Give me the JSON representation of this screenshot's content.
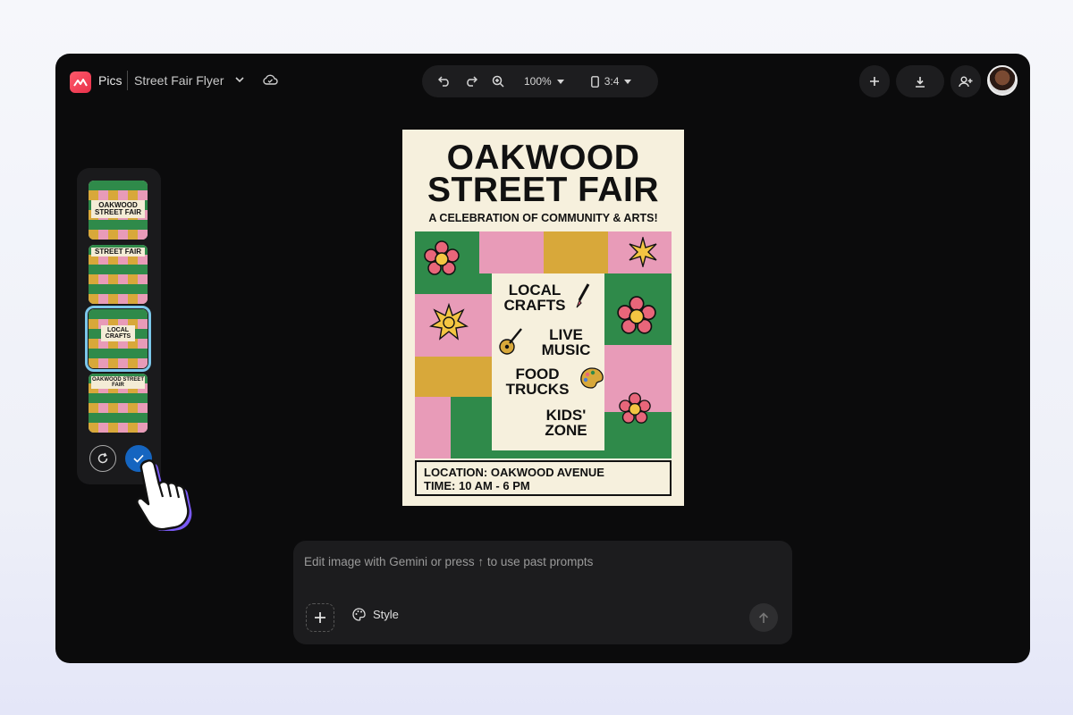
{
  "header": {
    "app_name": "Pics",
    "doc_title": "Street Fair Flyer",
    "zoom": "100%",
    "aspect_ratio": "3:4"
  },
  "thumbnails": [
    {
      "title": "OAKWOOD STREET FAIR"
    },
    {
      "title": "STREET FAIR"
    },
    {
      "title": "LOCAL CRAFTS"
    },
    {
      "title": "OAKWOOD STREET FAIR"
    }
  ],
  "selected_thumbnail": 3,
  "flyer": {
    "title_line1": "OAKWOOD",
    "title_line2": "STREET FAIR",
    "subtitle": "A CELEBRATION OF COMMUNITY & ARTS!",
    "features": [
      "LOCAL CRAFTS",
      "LIVE MUSIC",
      "FOOD TRUCKS",
      "KIDS' ZONE"
    ],
    "location": "LOCATION: OAKWOOD AVENUE",
    "time": "TIME: 10 AM - 6 PM"
  },
  "prompt": {
    "placeholder": "Edit image with Gemini or press ↑ to use past prompts",
    "style_label": "Style"
  },
  "colors": {
    "green": "#2f8a4a",
    "pink": "#e89bb8",
    "mustard": "#d8a83a",
    "cream": "#f6f0dd",
    "accent_blue": "#7cc7ea",
    "confirm_blue": "#1565c0"
  }
}
